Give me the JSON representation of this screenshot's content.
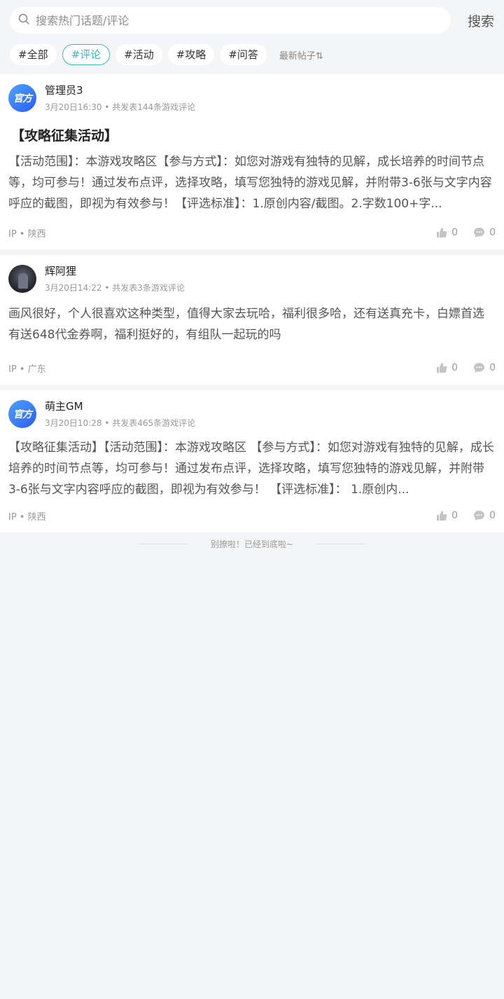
{
  "search": {
    "placeholder": "搜索热门话题/评论",
    "button": "搜索"
  },
  "tags": [
    {
      "label": "#全部"
    },
    {
      "label": "#评论",
      "active": true
    },
    {
      "label": "#活动"
    },
    {
      "label": "#攻略"
    },
    {
      "label": "#问答"
    }
  ],
  "sort_label": "最新帖子⇅",
  "posts": [
    {
      "avatar": "official-badge",
      "avatar_text": "官方",
      "author": "管理员3",
      "time": "3月20日16:30",
      "count": "共发表144条游戏评论",
      "title": "【攻略征集活动】",
      "content": "【活动范围】：本游戏攻略区【参与方式】：如您对游戏有独特的见解，成长培养的时间节点等，均可参与！通过发布点评，选择攻略，填写您独特的游戏见解，并附带3-6张与文字内容呼应的截图，即视为有效参与！【评选标准】：1.原创内容/截图。2.字数100+字...",
      "ip": "IP • 陕西",
      "likes": "0",
      "comments": "0"
    },
    {
      "avatar": "user-photo",
      "author": "辉阿狸",
      "time": "3月20日14:22",
      "count": "共发表3条游戏评论",
      "content": "画风很好，个人很喜欢这种类型，值得大家去玩哈，福利很多哈，还有送真充卡，白嫖首选 有送648代金券啊，福利挺好的，有组队一起玩的吗",
      "ip": "IP • 广东",
      "likes": "0",
      "comments": "0"
    },
    {
      "avatar": "official-badge",
      "avatar_text": "官方",
      "author": "萌主GM",
      "time": "3月20日10:28",
      "count": "共发表465条游戏评论",
      "content": "【攻略征集活动】【活动范围】：本游戏攻略区 【参与方式】：如您对游戏有独特的见解，成长培养的时间节点等，均可参与！通过发布点评，选择攻略，填写您独特的游戏见解，并附带3-6张与文字内容呼应的截图，即视为有效参与！ 【评选标准】： 1.原创内...",
      "ip": "IP • 陕西",
      "likes": "0",
      "comments": "0"
    }
  ],
  "end_text": "别撩啦！已经到底啦~",
  "colors": {
    "accent": "#3fb6bd",
    "official_badge": "#2a5cf0",
    "background": "#f4f5f7"
  }
}
